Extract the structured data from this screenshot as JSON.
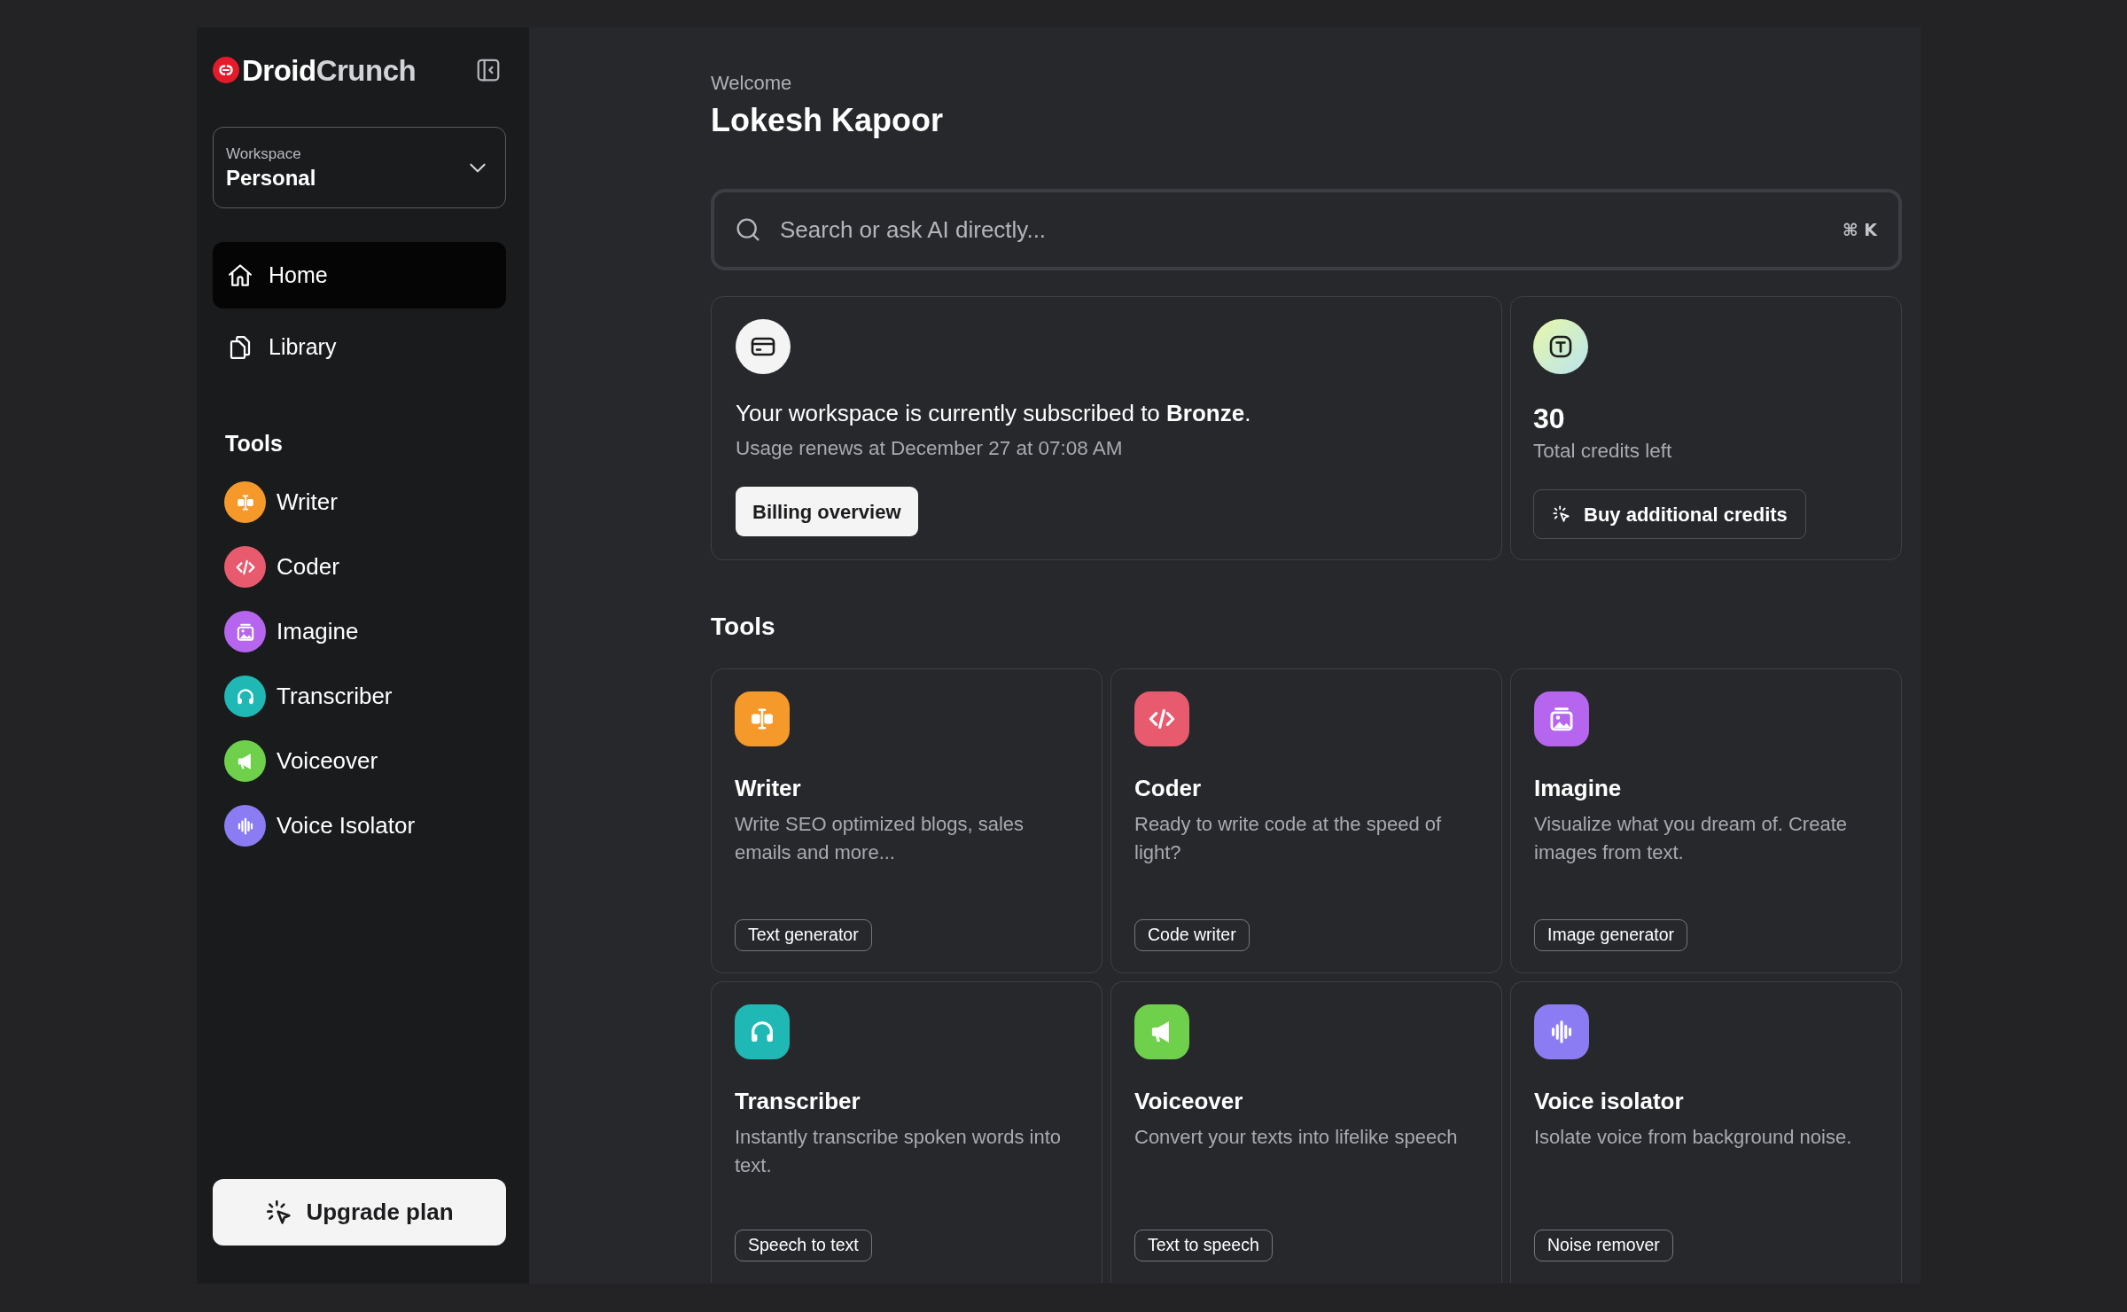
{
  "sidebar": {
    "logo": {
      "primary": "Droid",
      "secondary": "Crunch"
    },
    "workspace": {
      "label": "Workspace",
      "value": "Personal"
    },
    "nav": [
      {
        "label": "Home",
        "kind": "home",
        "selected": true
      },
      {
        "label": "Library",
        "kind": "library",
        "selected": false
      }
    ],
    "tools_heading": "Tools",
    "tools": [
      {
        "label": "Writer",
        "kind": "writer",
        "color": "#f59a2a"
      },
      {
        "label": "Coder",
        "kind": "coder",
        "color": "#e85a6e"
      },
      {
        "label": "Imagine",
        "kind": "imagine",
        "color": "#b565ee"
      },
      {
        "label": "Transcriber",
        "kind": "transcriber",
        "color": "#1fb8b4"
      },
      {
        "label": "Voiceover",
        "kind": "voiceover",
        "color": "#6fd04c"
      },
      {
        "label": "Voice Isolator",
        "kind": "isolator",
        "color": "#8c7cf3"
      }
    ],
    "upgrade_button": "Upgrade plan"
  },
  "header": {
    "greeting": "Welcome",
    "name": "Lokesh Kapoor"
  },
  "search": {
    "placeholder": "Search or ask AI directly...",
    "shortcut": "⌘ K"
  },
  "subscription": {
    "text": "Your workspace is currently subscribed to **Bronze**.",
    "renewal": "Usage renews at December 27 at 07:08 AM",
    "button": "Billing overview"
  },
  "credits": {
    "amount": "30",
    "label": "Total credits left",
    "button": "Buy additional credits"
  },
  "tools_section": {
    "heading": "Tools",
    "cards": [
      {
        "title": "Writer",
        "description": "Write SEO optimized blogs, sales emails and more...",
        "tag": "Text generator",
        "kind": "writer",
        "color": "#f59a2a"
      },
      {
        "title": "Coder",
        "description": "Ready to write code at the speed of light?",
        "tag": "Code writer",
        "kind": "coder",
        "color": "#e85a6e"
      },
      {
        "title": "Imagine",
        "description": "Visualize what you dream of. Create images from text.",
        "tag": "Image generator",
        "kind": "imagine",
        "color": "#b565ee"
      },
      {
        "title": "Transcriber",
        "description": "Instantly transcribe spoken words into text.",
        "tag": "Speech to text",
        "kind": "transcriber",
        "color": "#1fb8b4"
      },
      {
        "title": "Voiceover",
        "description": "Convert your texts into lifelike speech",
        "tag": "Text to speech",
        "kind": "voiceover",
        "color": "#6fd04c"
      },
      {
        "title": "Voice isolator",
        "description": "Isolate voice from background noise.",
        "tag": "Noise remover",
        "kind": "isolator",
        "color": "#8c7cf3"
      }
    ]
  }
}
